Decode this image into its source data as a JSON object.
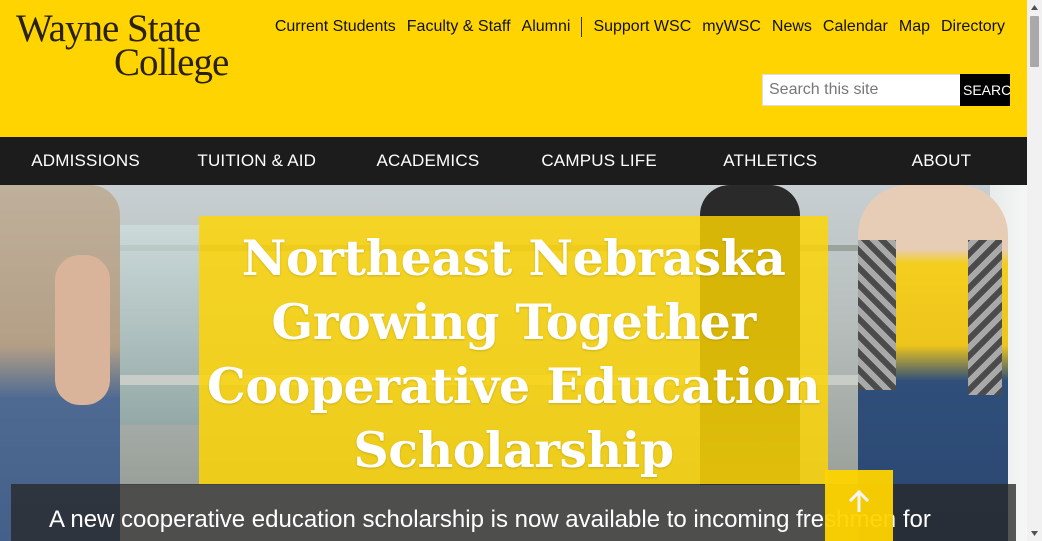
{
  "header": {
    "logo": {
      "line1": "Wayne State",
      "line2": "College"
    },
    "utility_links": [
      {
        "label": "Current Students"
      },
      {
        "label": "Faculty & Staff"
      },
      {
        "label": "Alumni"
      },
      {
        "label": "Support WSC"
      },
      {
        "label": "myWSC"
      },
      {
        "label": "News"
      },
      {
        "label": "Calendar"
      },
      {
        "label": "Map"
      },
      {
        "label": "Directory"
      }
    ],
    "search": {
      "placeholder": "Search this site",
      "value": "",
      "button_label": "SEARCH"
    }
  },
  "main_nav": [
    {
      "label": "ADMISSIONS"
    },
    {
      "label": "TUITION & AID"
    },
    {
      "label": "ACADEMICS"
    },
    {
      "label": "CAMPUS LIFE"
    },
    {
      "label": "ATHLETICS"
    },
    {
      "label": "ABOUT"
    }
  ],
  "hero": {
    "title": "Northeast Nebraska Growing Together Cooperative Education Scholarship",
    "caption": "A new cooperative education scholarship is now available to incoming freshmen for"
  },
  "back_to_top": {
    "icon": "arrow-up-icon"
  },
  "colors": {
    "brand_yellow": "#ffd400",
    "nav_background": "#1c1c1c",
    "logo_text": "#2a2208"
  }
}
